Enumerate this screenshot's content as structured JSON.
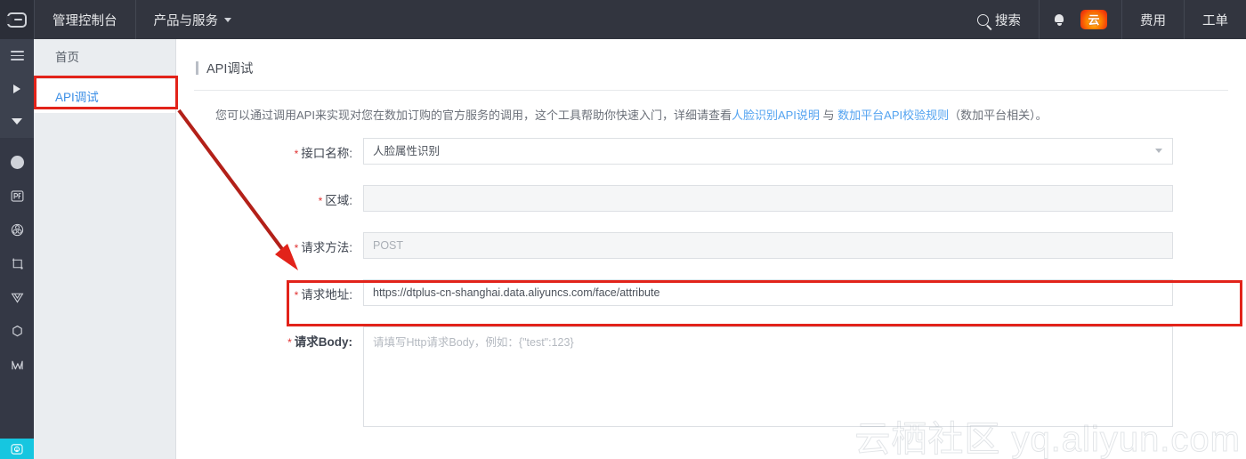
{
  "header": {
    "logo_icon": "aliyun-logo-icon",
    "console_label": "管理控制台",
    "products_label": "产品与服务",
    "products_caret_icon": "chevron-down-icon",
    "search_icon": "search-icon",
    "search_label": "搜索",
    "bell_icon": "bell-icon",
    "brand_badge_icon": "aliyun-brand-badge-icon",
    "brand_badge_text": "云",
    "billing_label": "费用",
    "ticket_label": "工单"
  },
  "rail": {
    "items": [
      {
        "icon": "hamburger-menu-icon"
      },
      {
        "icon": "triangle-right-icon"
      },
      {
        "icon": "triangle-down-icon"
      },
      {
        "icon": "circle-icon"
      },
      {
        "icon": "dataphin-icon"
      },
      {
        "icon": "flower-cluster-icon"
      },
      {
        "icon": "crop-frame-icon"
      },
      {
        "icon": "paper-plane-icon"
      },
      {
        "icon": "hexagon-icon"
      },
      {
        "icon": "chart-zigzag-icon"
      }
    ],
    "footer_icon": "camera-scan-icon"
  },
  "subnav": {
    "items": [
      {
        "label": "首页",
        "active": false
      },
      {
        "label": "API调试",
        "active": true
      }
    ]
  },
  "page": {
    "title": "API调试",
    "description_prefix": "您可以通过调用API来实现对您在数加订购的官方服务的调用，这个工具帮助你快速入门，详细请查看",
    "link1": "人脸识别API说明",
    "description_mid": " 与 ",
    "link2": "数加平台API校验规则",
    "description_suffix": "（数加平台相关）。"
  },
  "form": {
    "api_name": {
      "label": "接口名称:",
      "required_mark": "*",
      "value": "人脸属性识别",
      "caret_icon": "chevron-down-icon"
    },
    "region": {
      "label": "区域:",
      "required_mark": "*",
      "value": "",
      "redacted_icon": "red-scribble-redaction-icon"
    },
    "method": {
      "label": "请求方法:",
      "required_mark": "*",
      "value": "POST",
      "disabled": true
    },
    "url": {
      "label": "请求地址:",
      "required_mark": "*",
      "value": "https://dtplus-cn-shanghai.data.aliyuncs.com/face/attribute"
    },
    "body": {
      "label": "请求Body:",
      "required_mark": "*",
      "value": "",
      "placeholder": "请填写Http请求Body，例如：{\"test\":123}"
    }
  },
  "annotations": {
    "highlight_color": "#e2231a",
    "nav_box": "highlight-box-api-debug-nav",
    "url_box": "highlight-box-request-url-row",
    "arrow": "arrow-nav-to-request-url"
  },
  "watermark": {
    "text": "云栖社区 yq.aliyun.com"
  }
}
